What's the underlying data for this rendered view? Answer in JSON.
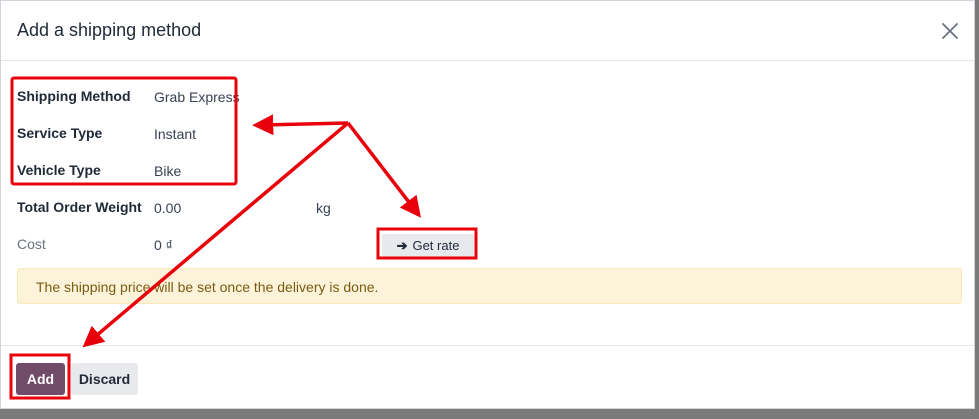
{
  "dialog": {
    "title": "Add a shipping method"
  },
  "form": {
    "shipping_method": {
      "label": "Shipping Method",
      "value": "Grab Express"
    },
    "service_type": {
      "label": "Service Type",
      "value": "Instant"
    },
    "vehicle_type": {
      "label": "Vehicle Type",
      "value": "Bike"
    },
    "total_weight": {
      "label": "Total Order Weight",
      "value": "0.00",
      "unit": "kg"
    },
    "cost": {
      "label": "Cost",
      "value": "0 ₫"
    }
  },
  "get_rate": {
    "arrow": "➔",
    "label": "Get rate"
  },
  "alert": {
    "text": "The shipping price will be set once the delivery is done."
  },
  "footer": {
    "add_label": "Add",
    "discard_label": "Discard"
  },
  "colors": {
    "primary": "#714b67",
    "annotation": "#e8000b",
    "alert_bg": "#fdf3da",
    "alert_text": "#7a5b10"
  },
  "icons": {
    "close": "close-icon",
    "arrow": "arrow-right-icon"
  }
}
